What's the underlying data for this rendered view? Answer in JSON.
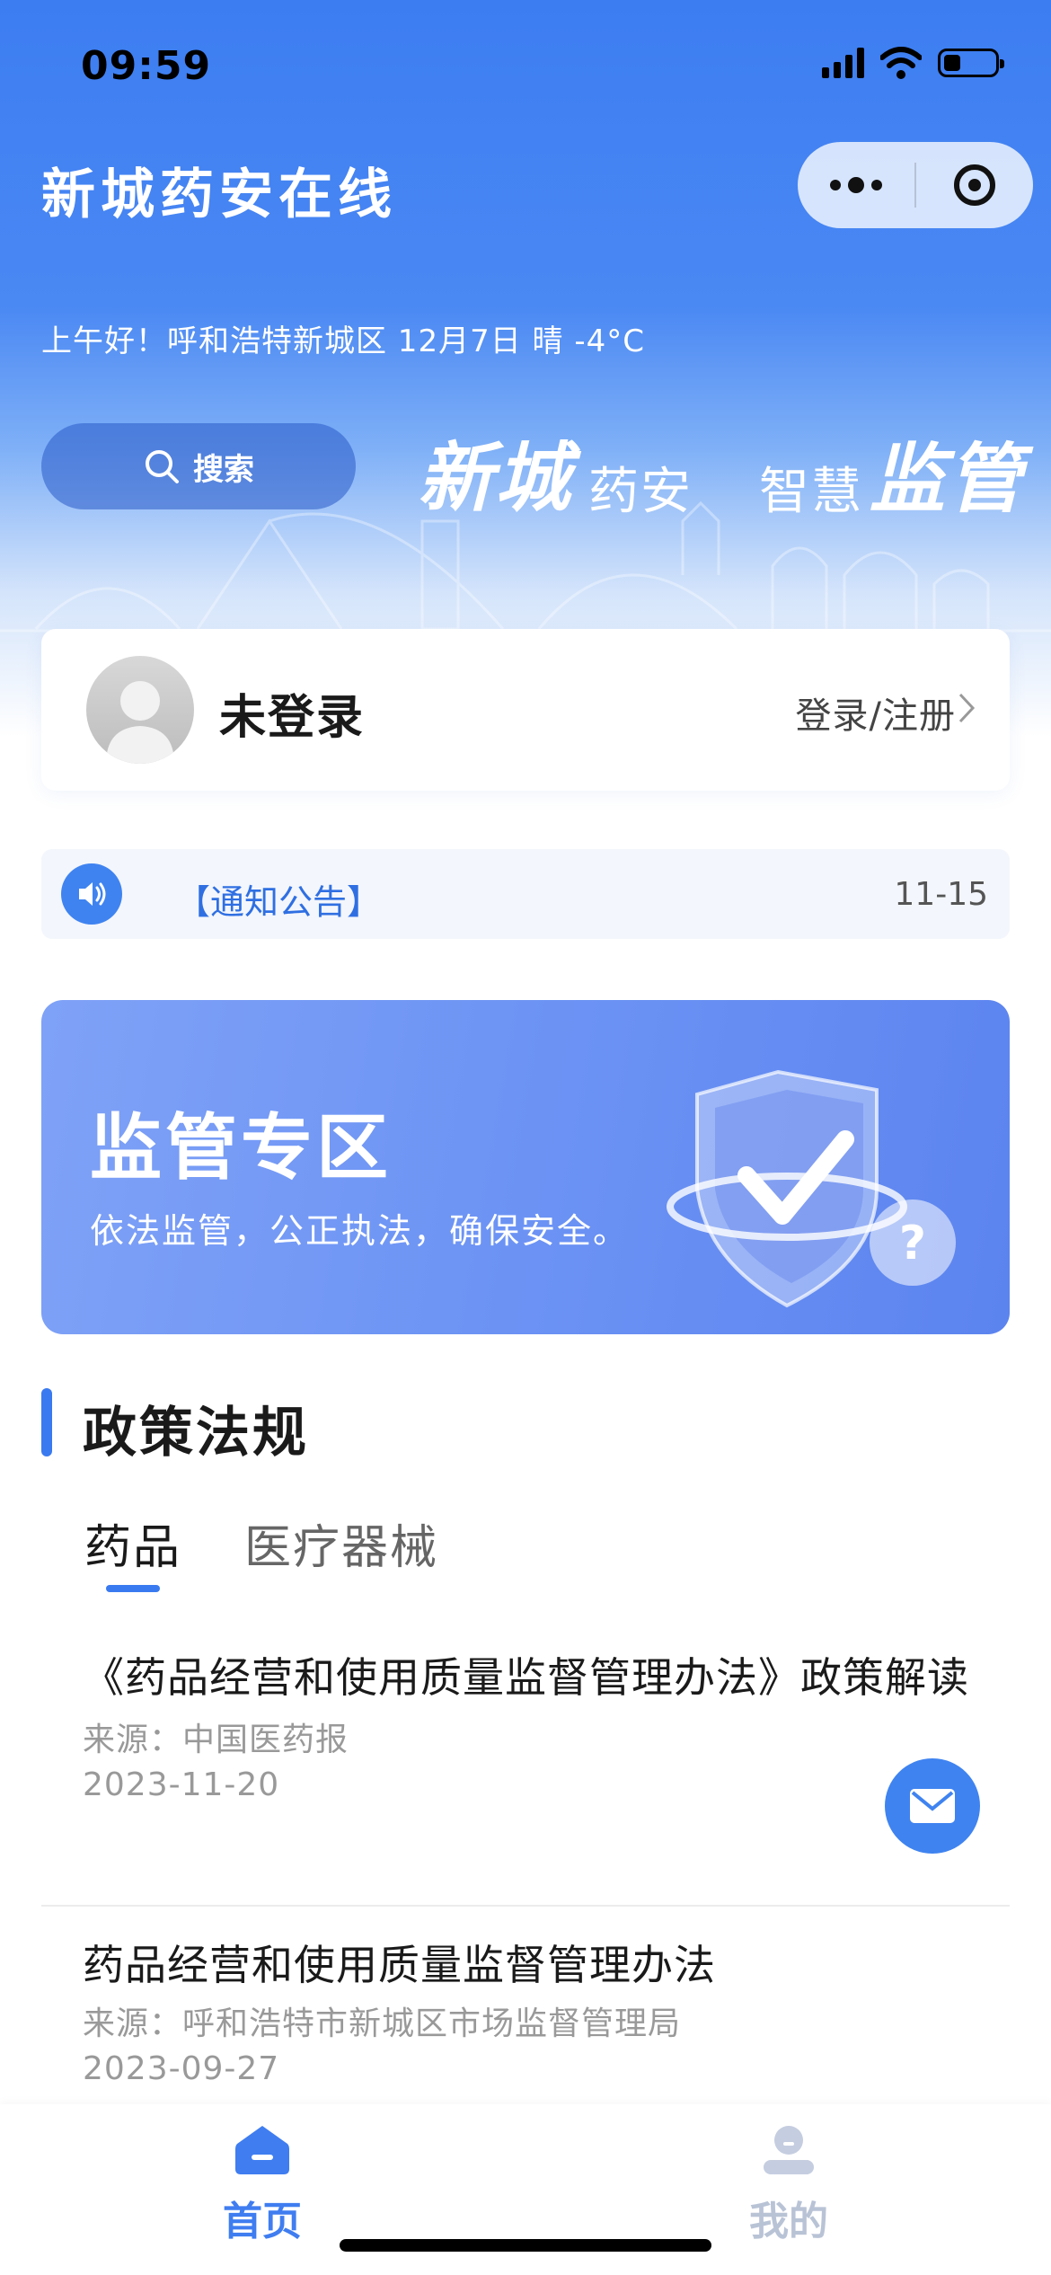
{
  "status_bar": {
    "time": "09:59"
  },
  "header": {
    "title": "新城药安在线",
    "greeting": "上午好！呼和浩特新城区 12月7日 晴 -4°C"
  },
  "capsule": {
    "more_icon": "more-dots-icon",
    "close_icon": "target-icon"
  },
  "search": {
    "label": "搜索",
    "icon": "search-icon"
  },
  "banner": {
    "brand_script": "新城",
    "brand_plain": "药安",
    "slogan_plain": "智慧",
    "slogan_script": "监管"
  },
  "login_card": {
    "user_name": "未登录",
    "login_link": "登录/注册"
  },
  "notice": {
    "tag": "【通知公告】",
    "date": "11-15"
  },
  "zone": {
    "title": "监管专区",
    "subtitle": "依法监管，公正执法，确保安全。"
  },
  "section": {
    "title": "政策法规",
    "tabs": [
      {
        "label": "药品",
        "active": true
      },
      {
        "label": "医疗器械",
        "active": false
      }
    ]
  },
  "articles": [
    {
      "title": "《药品经营和使用质量监督管理办法》政策解读",
      "source": "来源：中国医药报",
      "date": "2023-11-20"
    },
    {
      "title": "药品经营和使用质量监督管理办法",
      "source": "来源：呼和浩特市新城区市场监督管理局",
      "date": "2023-09-27"
    }
  ],
  "tabbar": {
    "items": [
      {
        "label": "首页",
        "icon": "home-icon",
        "active": true
      },
      {
        "label": "我的",
        "icon": "profile-icon",
        "active": false
      }
    ]
  },
  "colors": {
    "primary": "#3F7DF0",
    "hero_top": "#3C7DF2",
    "inactive": "#B9C3D6"
  }
}
